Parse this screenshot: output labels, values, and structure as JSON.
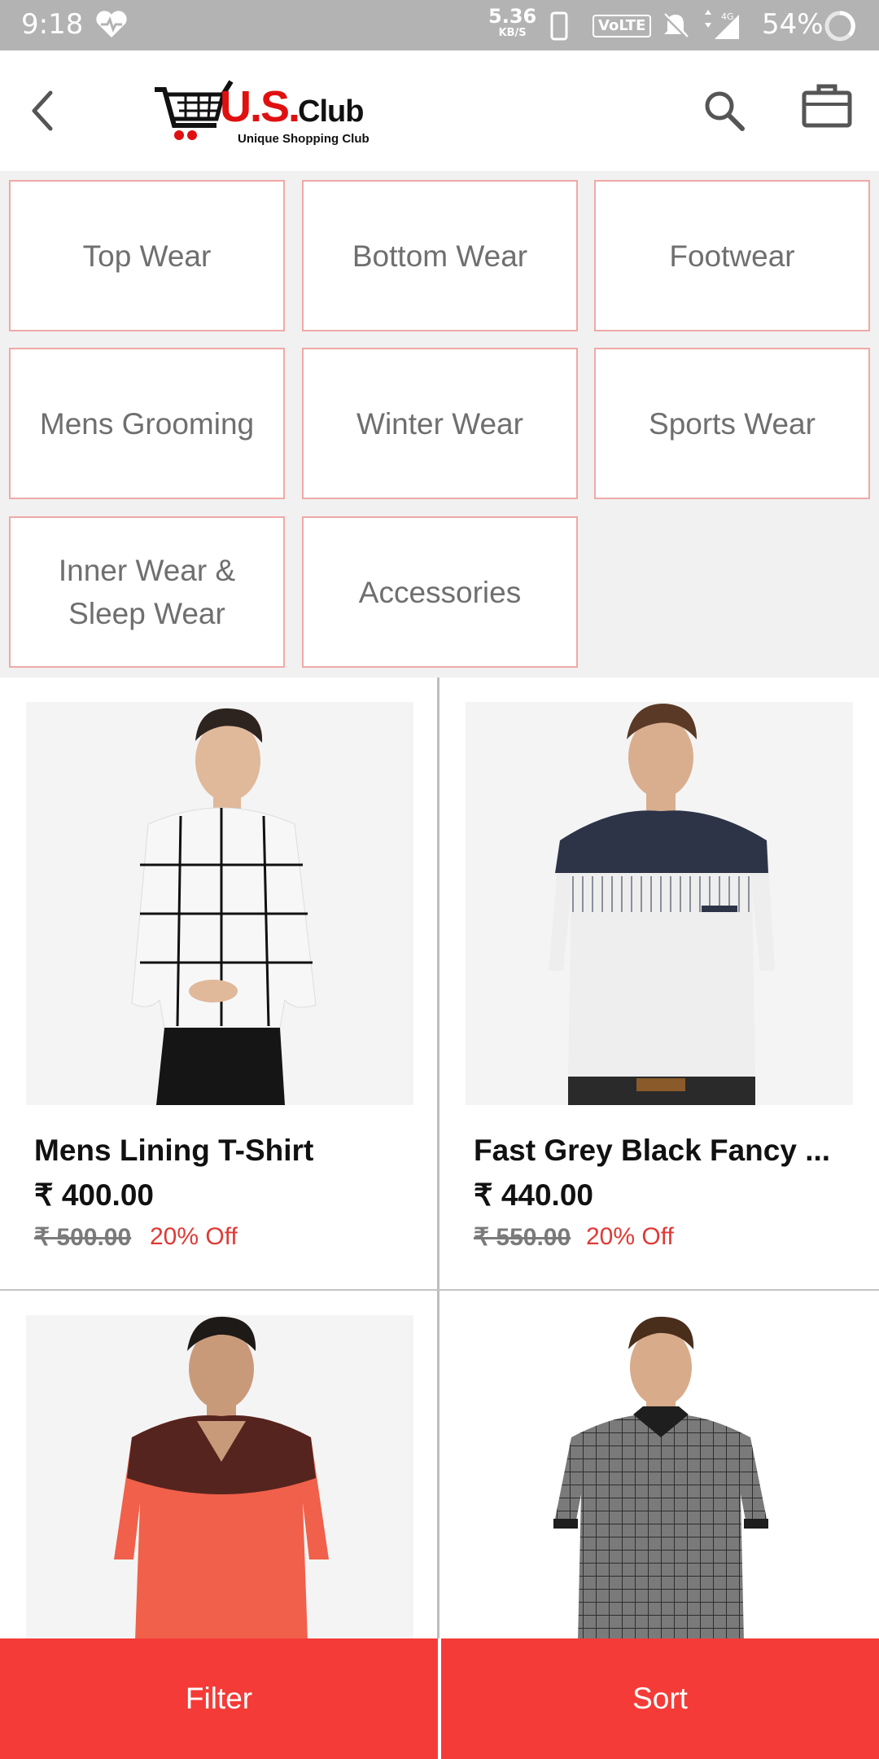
{
  "status_bar": {
    "time": "9:18",
    "net_speed_value": "5.36",
    "net_speed_unit": "KB/S",
    "volte": "VoLTE",
    "network": "4G",
    "battery": "54%"
  },
  "header": {
    "logo_main": "U.S.",
    "logo_club": "Club",
    "logo_tagline": "Unique Shopping Club",
    "brand_color": "#e01010"
  },
  "categories": [
    {
      "label": "Top Wear"
    },
    {
      "label": "Bottom Wear"
    },
    {
      "label": "Footwear"
    },
    {
      "label": "Mens Grooming"
    },
    {
      "label": "Winter Wear"
    },
    {
      "label": "Sports Wear"
    },
    {
      "label": "Inner Wear & Sleep Wear"
    },
    {
      "label": "Accessories"
    }
  ],
  "products": [
    {
      "name": "Mens Lining T-Shirt",
      "price": "₹ 400.00",
      "mrp": "₹ 500.00",
      "discount": "20% Off",
      "image": "white-checked-sweater"
    },
    {
      "name": "Fast Grey Black Fancy ...",
      "price": "₹ 440.00",
      "mrp": "₹ 550.00",
      "discount": "20% Off",
      "image": "navy-grey-white-tshirt"
    },
    {
      "name": "",
      "price": "",
      "mrp": "",
      "discount": "",
      "image": "red-black-vneck-tshirt"
    },
    {
      "name": "",
      "price": "",
      "mrp": "",
      "discount": "",
      "image": "grey-checked-polo"
    }
  ],
  "actions": {
    "filter_label": "Filter",
    "sort_label": "Sort",
    "accent_color": "#f53b37"
  }
}
